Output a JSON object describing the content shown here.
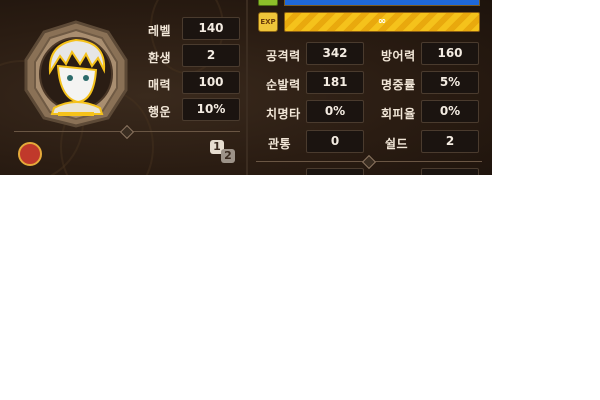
{
  "exp_bar": {
    "icon_label": "EXP",
    "value": "∞"
  },
  "character": {
    "level_label": "레벨",
    "level": "140",
    "rebirth_label": "환생",
    "rebirth": "2",
    "charm_label": "매력",
    "charm": "100",
    "luck_label": "행운",
    "luck": "10%"
  },
  "stats": {
    "attack_label": "공격력",
    "attack": "342",
    "defense_label": "방어력",
    "defense": "160",
    "agility_label": "순발력",
    "agility": "181",
    "accuracy_label": "명중률",
    "accuracy": "5%",
    "crit_label": "치명타",
    "crit": "0%",
    "evasion_label": "회피율",
    "evasion": "0%",
    "pierce_label": "관통",
    "pierce": "0",
    "shield_label": "쉴드",
    "shield": "2"
  },
  "page_indicator": {
    "current": "1",
    "total": "2"
  },
  "colors": {
    "panel_bg": "#2a1c12",
    "value_box": "#1b1410",
    "hp": "#1f68d8",
    "exp": "#f5c21b"
  },
  "icons": [
    "top-icon",
    "exp-icon",
    "portrait-avatar",
    "guild-emblem-icon",
    "page-switch-icon"
  ]
}
